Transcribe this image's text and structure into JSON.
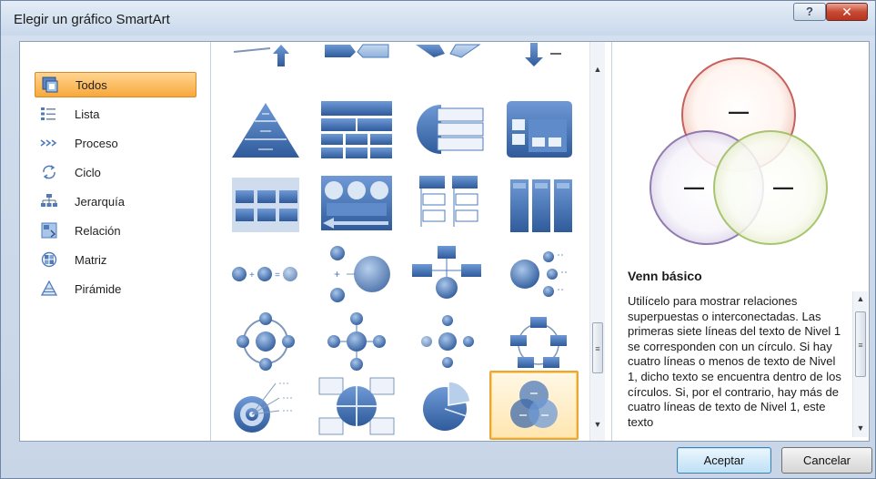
{
  "window": {
    "title": "Elegir un gráfico SmartArt",
    "help_label": "?",
    "close_label": "✕"
  },
  "categories": [
    {
      "label": "Todos",
      "icon": "all-icon",
      "selected": true
    },
    {
      "label": "Lista",
      "icon": "list-icon"
    },
    {
      "label": "Proceso",
      "icon": "process-icon"
    },
    {
      "label": "Ciclo",
      "icon": "cycle-icon"
    },
    {
      "label": "Jerarquía",
      "icon": "hierarchy-icon"
    },
    {
      "label": "Relación",
      "icon": "relationship-icon"
    },
    {
      "label": "Matriz",
      "icon": "matrix-icon"
    },
    {
      "label": "Pirámide",
      "icon": "pyramid-icon"
    }
  ],
  "gallery": {
    "selected_item": "venn-basic",
    "scroll_up_label": "▲",
    "scroll_down_label": "▼"
  },
  "preview": {
    "title": "Venn básico",
    "venn_label": "—",
    "description": "Utilícelo para mostrar relaciones superpuestas o interconectadas. Las primeras siete líneas del texto de Nivel 1 se corresponden con un círculo. Si hay cuatro líneas o menos de texto de Nivel 1, dicho texto se encuentra dentro de los círculos. Si, por el contrario, hay más de cuatro líneas de texto de Nivel 1, este texto",
    "scroll_up_label": "▲",
    "scroll_down_label": "▼"
  },
  "buttons": {
    "ok_label": "Aceptar",
    "cancel_label": "Cancelar"
  },
  "colors": {
    "accent": "#4f7bb8",
    "selection": "#f8a83b"
  }
}
